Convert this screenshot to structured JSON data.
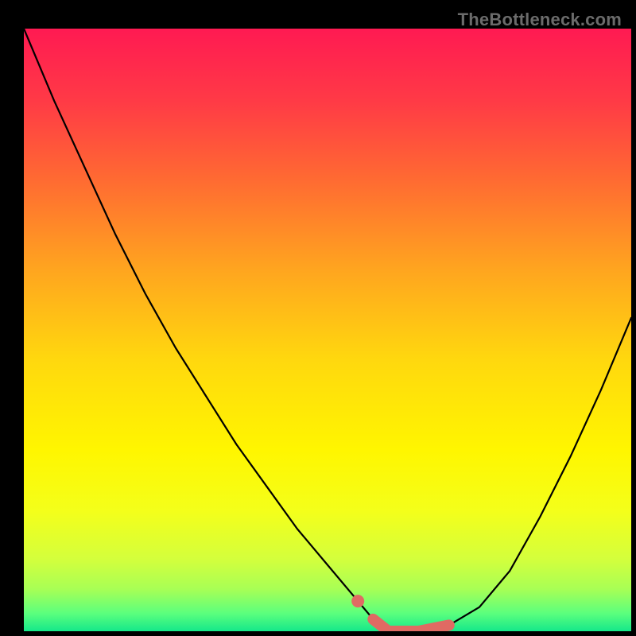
{
  "watermark": "TheBottleneck.com",
  "colors": {
    "gradient_stops": [
      {
        "offset": 0.0,
        "color": "#ff1a52"
      },
      {
        "offset": 0.12,
        "color": "#ff3a46"
      },
      {
        "offset": 0.25,
        "color": "#ff6a32"
      },
      {
        "offset": 0.4,
        "color": "#ffa51f"
      },
      {
        "offset": 0.55,
        "color": "#ffd80e"
      },
      {
        "offset": 0.7,
        "color": "#fff600"
      },
      {
        "offset": 0.8,
        "color": "#f4ff1a"
      },
      {
        "offset": 0.88,
        "color": "#d4ff3c"
      },
      {
        "offset": 0.93,
        "color": "#a8ff55"
      },
      {
        "offset": 0.97,
        "color": "#5cff7d"
      },
      {
        "offset": 1.0,
        "color": "#15e88a"
      }
    ],
    "curve": "#000000",
    "highlight": "#e06a63",
    "frame": "#000000"
  },
  "chart_data": {
    "type": "line",
    "x": [
      0.0,
      0.05,
      0.1,
      0.15,
      0.2,
      0.25,
      0.3,
      0.35,
      0.4,
      0.45,
      0.5,
      0.55,
      0.575,
      0.6,
      0.65,
      0.7,
      0.75,
      0.8,
      0.85,
      0.9,
      0.95,
      1.0
    ],
    "values": [
      100,
      88,
      77,
      66,
      56,
      47,
      39,
      31,
      24,
      17,
      11,
      5,
      2,
      0,
      0,
      1,
      4,
      10,
      19,
      29,
      40,
      52
    ],
    "highlight_x_range": [
      0.55,
      0.72
    ],
    "title": "",
    "xlabel": "",
    "ylabel": "",
    "xlim": [
      0,
      1
    ],
    "ylim": [
      0,
      100
    ]
  }
}
